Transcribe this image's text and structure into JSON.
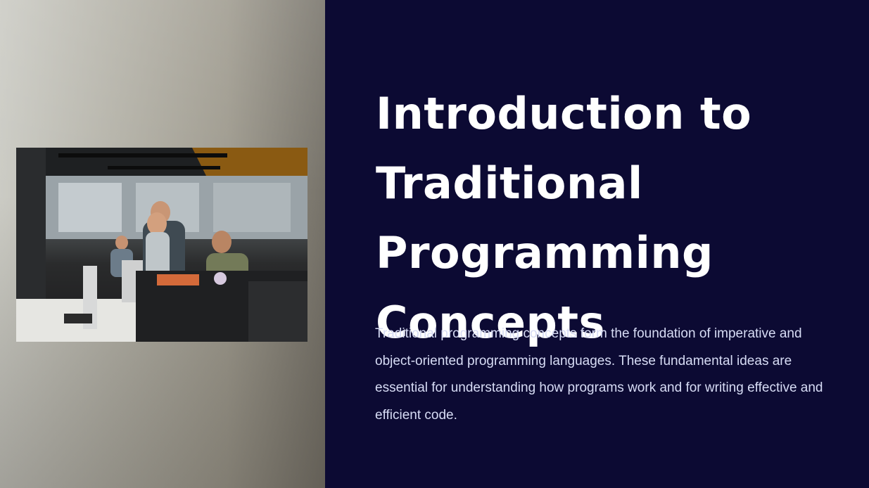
{
  "slide": {
    "title": "Introduction to Traditional Programming Concepts",
    "description": "Traditional programming concepts form the foundation of imperative and object-oriented programming languages. These fundamental ideas are essential for understanding how programs work and for writing effective and efficient code."
  },
  "colors": {
    "background": "#0c0a33",
    "title": "#ffffff",
    "description": "#d7dcf5"
  },
  "photo": {
    "subject": "team-of-developers-in-office-photo"
  }
}
